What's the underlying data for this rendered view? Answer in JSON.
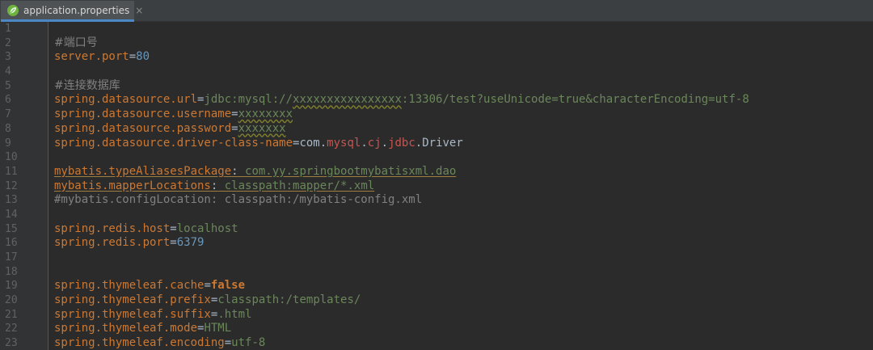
{
  "tab": {
    "title": "application.properties",
    "close": "×",
    "icon": "spring-leaf-icon"
  },
  "lines": [
    {
      "n": "1",
      "parts": []
    },
    {
      "n": "2",
      "parts": [
        {
          "t": "#端口号",
          "c": "com"
        }
      ]
    },
    {
      "n": "3",
      "parts": [
        {
          "t": "server.port",
          "c": "key"
        },
        {
          "t": "=",
          "c": "eq"
        },
        {
          "t": "80",
          "c": "num"
        }
      ]
    },
    {
      "n": "4",
      "parts": []
    },
    {
      "n": "5",
      "parts": [
        {
          "t": "#连接数据库",
          "c": "com"
        }
      ]
    },
    {
      "n": "6",
      "parts": [
        {
          "t": "spring.datasource.url",
          "c": "key"
        },
        {
          "t": "=",
          "c": "eq"
        },
        {
          "t": "jdbc:mysql://",
          "c": "str"
        },
        {
          "t": "xxxxxxxxxxxxxxxx",
          "c": "str wavy"
        },
        {
          "t": ":13306/test?useUnicode=true&characterEncoding=utf-8",
          "c": "str"
        }
      ]
    },
    {
      "n": "7",
      "parts": [
        {
          "t": "spring.datasource.username",
          "c": "key"
        },
        {
          "t": "=",
          "c": "eq"
        },
        {
          "t": "xxxxxxxx",
          "c": "str wavy"
        }
      ]
    },
    {
      "n": "8",
      "parts": [
        {
          "t": "spring.datasource.password",
          "c": "key"
        },
        {
          "t": "=",
          "c": "eq"
        },
        {
          "t": "xxxxxxx",
          "c": "str wavy"
        }
      ]
    },
    {
      "n": "9",
      "parts": [
        {
          "t": "spring.datasource.driver-class-name",
          "c": "key"
        },
        {
          "t": "=",
          "c": "eq"
        },
        {
          "t": "com.",
          "c": "plain"
        },
        {
          "t": "mysql",
          "c": "red"
        },
        {
          "t": ".",
          "c": "plain"
        },
        {
          "t": "cj",
          "c": "red"
        },
        {
          "t": ".",
          "c": "plain"
        },
        {
          "t": "jdbc",
          "c": "red"
        },
        {
          "t": ".Driver",
          "c": "plain"
        }
      ]
    },
    {
      "n": "10",
      "parts": []
    },
    {
      "n": "11",
      "parts": [
        {
          "t": "mybatis.typeAliasesPackage",
          "c": "key uline"
        },
        {
          "t": ":",
          "c": "eq uline"
        },
        {
          "t": " com.yy.springbootmybatisxml.dao",
          "c": "str uline"
        }
      ]
    },
    {
      "n": "12",
      "parts": [
        {
          "t": "mybatis.mapperLocations",
          "c": "key uline"
        },
        {
          "t": ":",
          "c": "eq uline"
        },
        {
          "t": " classpath:mapper/*.xml",
          "c": "str uline"
        }
      ]
    },
    {
      "n": "13",
      "parts": [
        {
          "t": "#mybatis.configLocation: classpath:/mybatis-config.xml",
          "c": "com"
        }
      ]
    },
    {
      "n": "14",
      "parts": []
    },
    {
      "n": "15",
      "parts": [
        {
          "t": "spring.redis.host",
          "c": "key"
        },
        {
          "t": "=",
          "c": "eq"
        },
        {
          "t": "localhost",
          "c": "str"
        }
      ]
    },
    {
      "n": "16",
      "parts": [
        {
          "t": "spring.redis.port",
          "c": "key"
        },
        {
          "t": "=",
          "c": "eq"
        },
        {
          "t": "6379",
          "c": "num"
        }
      ]
    },
    {
      "n": "17",
      "parts": []
    },
    {
      "n": "18",
      "parts": []
    },
    {
      "n": "19",
      "parts": [
        {
          "t": "spring.thymeleaf.cache",
          "c": "key"
        },
        {
          "t": "=",
          "c": "eq"
        },
        {
          "t": "false",
          "c": "bold"
        }
      ]
    },
    {
      "n": "20",
      "parts": [
        {
          "t": "spring.thymeleaf.prefix",
          "c": "key"
        },
        {
          "t": "=",
          "c": "eq"
        },
        {
          "t": "classpath:/templates/",
          "c": "str"
        }
      ]
    },
    {
      "n": "21",
      "parts": [
        {
          "t": "spring.thymeleaf.suffix",
          "c": "key"
        },
        {
          "t": "=",
          "c": "eq"
        },
        {
          "t": ".html",
          "c": "str"
        }
      ]
    },
    {
      "n": "22",
      "parts": [
        {
          "t": "spring.thymeleaf.mode",
          "c": "key"
        },
        {
          "t": "=",
          "c": "eq"
        },
        {
          "t": "HTML",
          "c": "str"
        }
      ]
    },
    {
      "n": "23",
      "parts": [
        {
          "t": "spring.thymeleaf.encoding",
          "c": "key"
        },
        {
          "t": "=",
          "c": "eq"
        },
        {
          "t": "utf-8",
          "c": "str"
        }
      ]
    }
  ]
}
